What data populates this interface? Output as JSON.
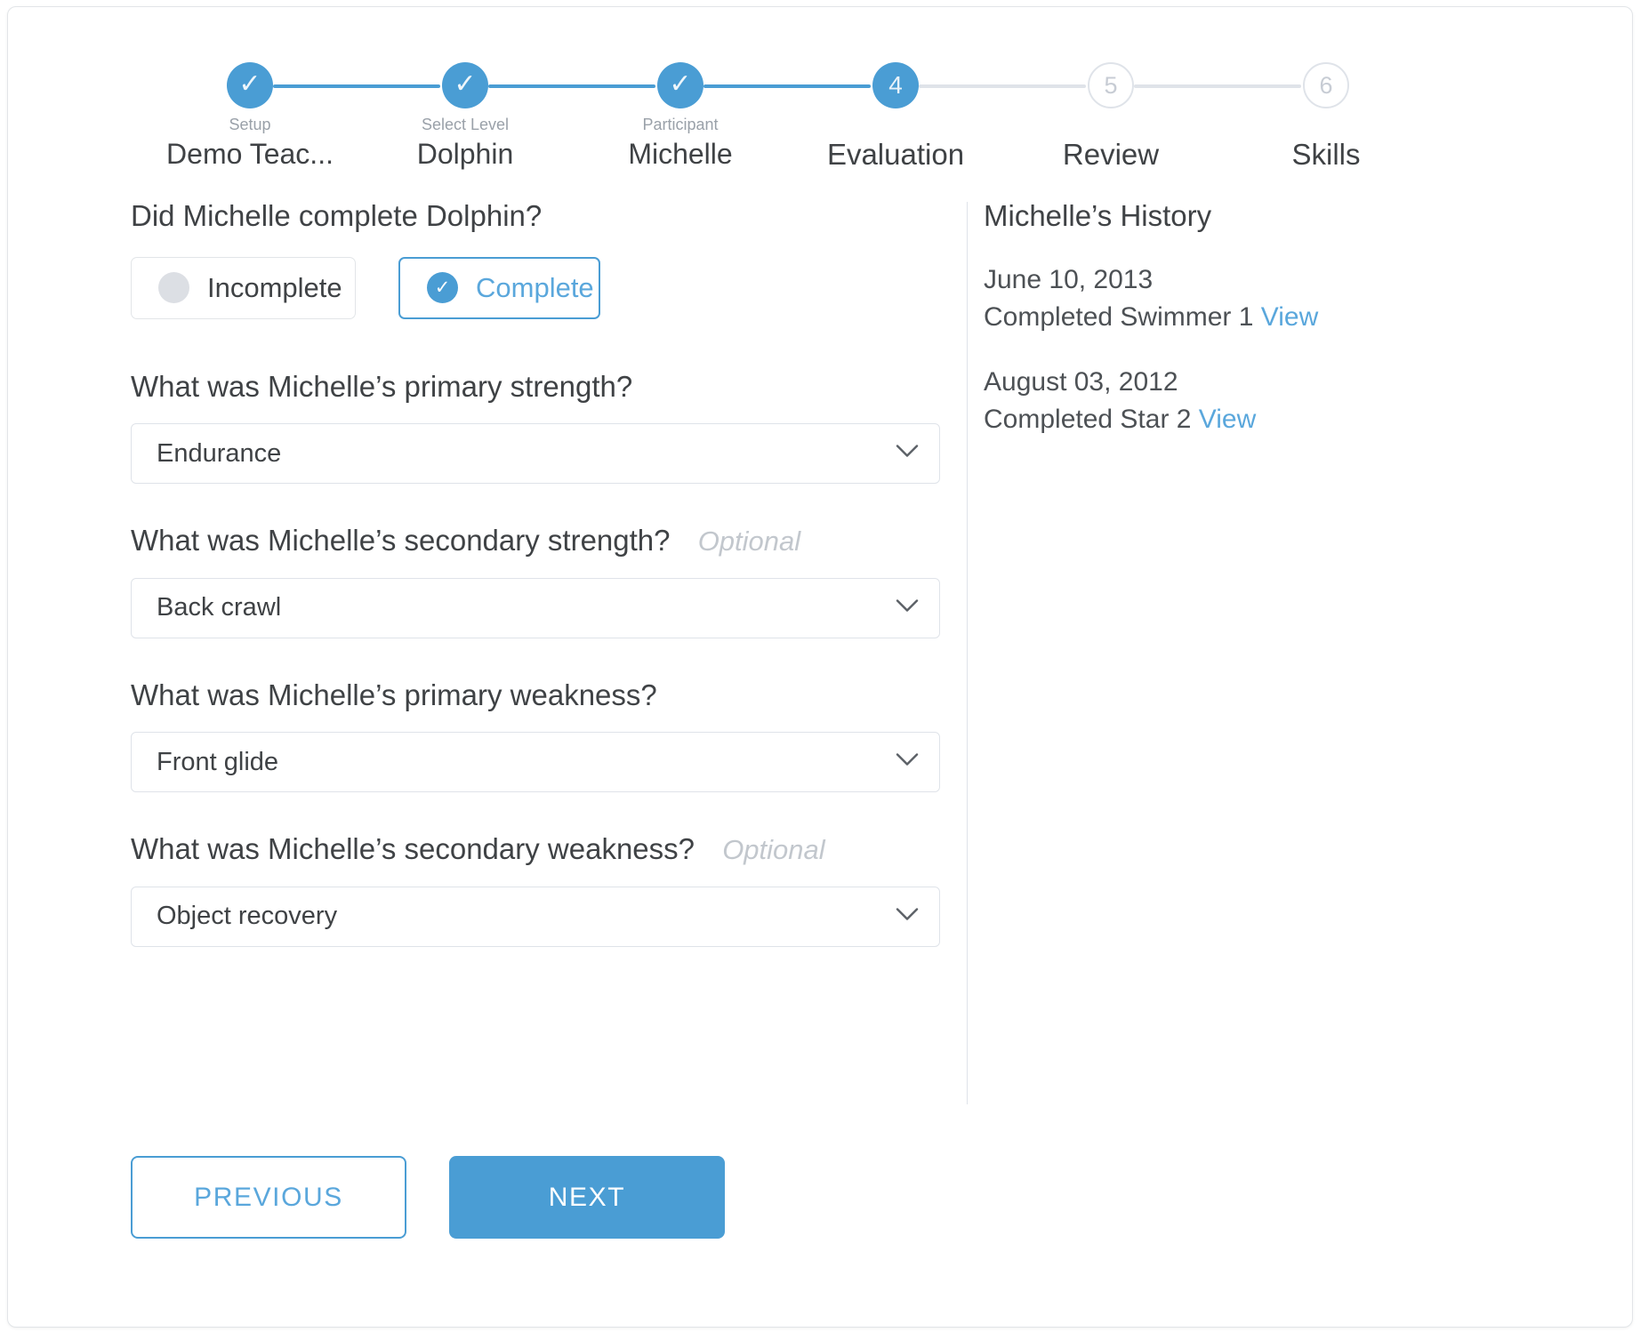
{
  "stepper": {
    "steps": [
      {
        "sublabel": "Setup",
        "title": "Demo Teac...",
        "state": "done",
        "marker": "✓"
      },
      {
        "sublabel": "Select Level",
        "title": "Dolphin",
        "state": "done",
        "marker": "✓"
      },
      {
        "sublabel": "Participant",
        "title": "Michelle",
        "state": "done",
        "marker": "✓"
      },
      {
        "sublabel": "",
        "title": "Evaluation",
        "state": "current",
        "marker": "4"
      },
      {
        "sublabel": "",
        "title": "Review",
        "state": "pending",
        "marker": "5"
      },
      {
        "sublabel": "",
        "title": "Skills",
        "state": "pending",
        "marker": "6"
      }
    ]
  },
  "form": {
    "completion_question": "Did Michelle complete Dolphin?",
    "toggle_incomplete": "Incomplete",
    "toggle_complete": "Complete",
    "check_glyph": "✓",
    "fields": [
      {
        "question": "What was Michelle’s primary strength?",
        "optional": "",
        "value": "Endurance"
      },
      {
        "question": "What was Michelle’s secondary strength?",
        "optional": "Optional",
        "value": "Back crawl"
      },
      {
        "question": "What was Michelle’s primary weakness?",
        "optional": "",
        "value": "Front glide"
      },
      {
        "question": "What was Michelle’s secondary weakness?",
        "optional": "Optional",
        "value": "Object recovery"
      }
    ],
    "previous_label": "PREVIOUS",
    "next_label": "NEXT"
  },
  "history": {
    "title": "Michelle’s History",
    "entries": [
      {
        "date": "June 10, 2013",
        "description": "Completed Swimmer 1",
        "link": "View"
      },
      {
        "date": "August 03, 2012",
        "description": "Completed Star 2",
        "link": "View"
      }
    ]
  },
  "colors": {
    "accent": "#4a9dd4",
    "link": "#5aa7dc",
    "inactive": "#dfe3e9",
    "text": "#3f4245",
    "muted": "#9aa1a9"
  }
}
